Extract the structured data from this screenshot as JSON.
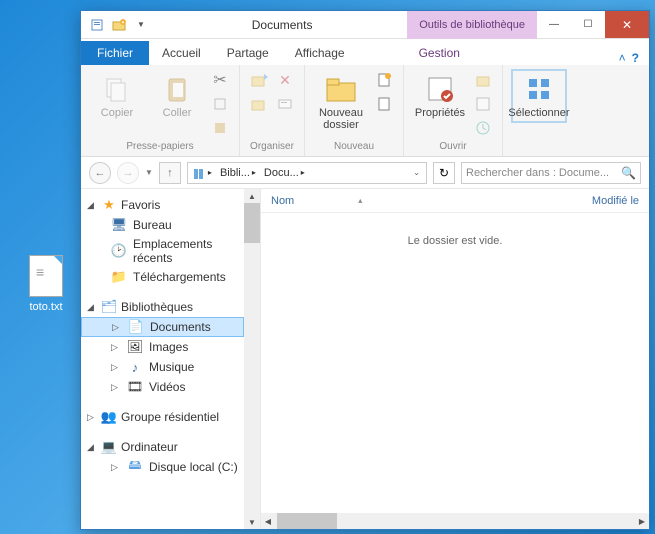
{
  "desktop": {
    "file_name": "toto.txt"
  },
  "window": {
    "title": "Documents",
    "context_tab_header": "Outils de bibliothèque",
    "tabs": {
      "file": "Fichier",
      "home": "Accueil",
      "share": "Partage",
      "view": "Affichage",
      "manage": "Gestion"
    }
  },
  "ribbon": {
    "clipboard": {
      "copy": "Copier",
      "paste": "Coller",
      "group": "Presse-papiers"
    },
    "organize": {
      "group": "Organiser"
    },
    "new": {
      "new_folder": "Nouveau dossier",
      "group": "Nouveau"
    },
    "open": {
      "properties": "Propriétés",
      "group": "Ouvrir"
    },
    "select": {
      "select": "Sélectionner"
    }
  },
  "addr": {
    "crumb_libraries": "Bibli...",
    "crumb_documents": "Docu..."
  },
  "search": {
    "placeholder": "Rechercher dans : Docume..."
  },
  "sidebar": {
    "favorites": {
      "label": "Favoris",
      "items": [
        "Bureau",
        "Emplacements récents",
        "Téléchargements"
      ]
    },
    "libraries": {
      "label": "Bibliothèques",
      "items": [
        "Documents",
        "Images",
        "Musique",
        "Vidéos"
      ]
    },
    "homegroup": {
      "label": "Groupe résidentiel"
    },
    "computer": {
      "label": "Ordinateur",
      "items": [
        "Disque local (C:)"
      ]
    }
  },
  "main": {
    "col_name": "Nom",
    "col_modified": "Modifié le",
    "empty": "Le dossier est vide."
  }
}
